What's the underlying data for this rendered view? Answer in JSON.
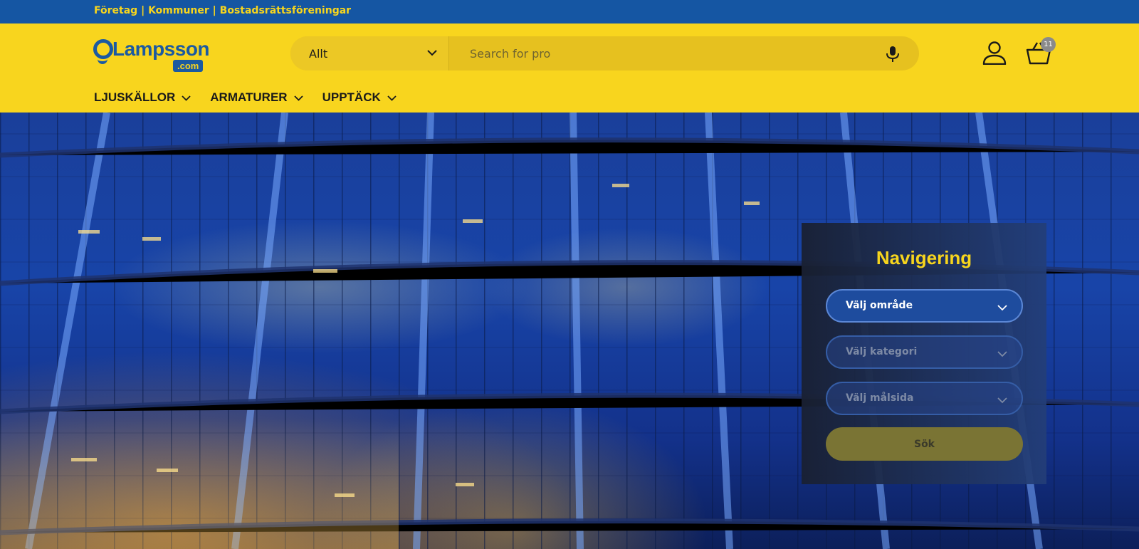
{
  "topbar": {
    "links": [
      "Företag",
      "Kommuner",
      "Bostadsrättsföreningar"
    ],
    "separator": " | "
  },
  "logo": {
    "name": "Lampsson",
    "suffix": ".com"
  },
  "search": {
    "category_selected": "Allt",
    "placeholder": "Search for pro"
  },
  "header_icons": {
    "account": "account-icon",
    "cart": "cart-icon",
    "cart_count": "11"
  },
  "nav": {
    "items": [
      {
        "label": "LJUSKÄLLOR"
      },
      {
        "label": "ARMATURER"
      },
      {
        "label": "UPPTÄCK"
      }
    ]
  },
  "navigation_panel": {
    "title": "Navigering",
    "selects": [
      {
        "label": "Välj område",
        "active": true
      },
      {
        "label": "Välj kategori",
        "active": false
      },
      {
        "label": "Välj målsida",
        "active": false
      }
    ],
    "submit_label": "Sök"
  },
  "colors": {
    "topbar": "#1556a3",
    "header": "#f8d51e",
    "accent_yellow": "#f7d51d",
    "brand_blue": "#1b5aa1"
  }
}
